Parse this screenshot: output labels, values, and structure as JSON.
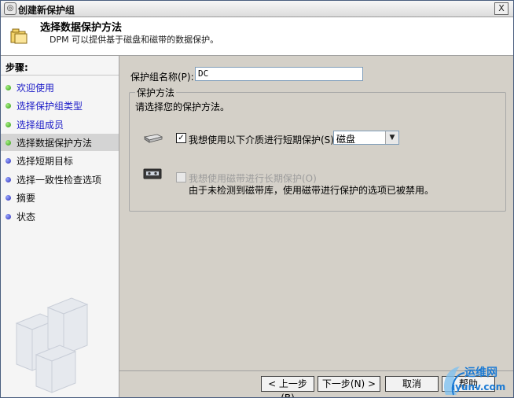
{
  "window": {
    "title": "创建新保护组",
    "close_label": "X"
  },
  "header": {
    "title": "选择数据保护方法",
    "subtitle": "DPM 可以提供基于磁盘和磁带的数据保护。"
  },
  "sidebar": {
    "steps_label": "步骤:",
    "steps": [
      {
        "label": "欢迎使用",
        "dot": "green",
        "link": true
      },
      {
        "label": "选择保护组类型",
        "dot": "green",
        "link": true
      },
      {
        "label": "选择组成员",
        "dot": "green",
        "link": true
      },
      {
        "label": "选择数据保护方法",
        "dot": "green",
        "link": false,
        "current": true
      },
      {
        "label": "选择短期目标",
        "dot": "blue",
        "link": false
      },
      {
        "label": "选择一致性检查选项",
        "dot": "blue",
        "link": false
      },
      {
        "label": "摘要",
        "dot": "blue",
        "link": false
      },
      {
        "label": "状态",
        "dot": "blue",
        "link": false
      }
    ]
  },
  "main": {
    "group_name_label": "保护组名称(P):",
    "group_name_value": "DC",
    "protection_legend": "保护方法",
    "choose_prompt": "请选择您的保护方法。",
    "short_term": {
      "label": "我想使用以下介质进行短期保护(S):",
      "checked": true,
      "media_value": "磁盘"
    },
    "long_term": {
      "label": "我想使用磁带进行长期保护(O)",
      "checked": false,
      "disabled": true,
      "note": "由于未检测到磁带库，使用磁带进行保护的选项已被禁用。"
    }
  },
  "buttons": {
    "back": "< 上一步(B)",
    "next": "下一步(N) >",
    "cancel": "取消",
    "help": "帮助"
  },
  "watermark": {
    "line1": "运维网",
    "line2": "iyunv.com"
  },
  "colors": {
    "link": "#1c1cc8",
    "title_bar": "#dcdcdc",
    "dialog_bg": "#d4d0c8",
    "watermark": "#1b7ad4"
  }
}
